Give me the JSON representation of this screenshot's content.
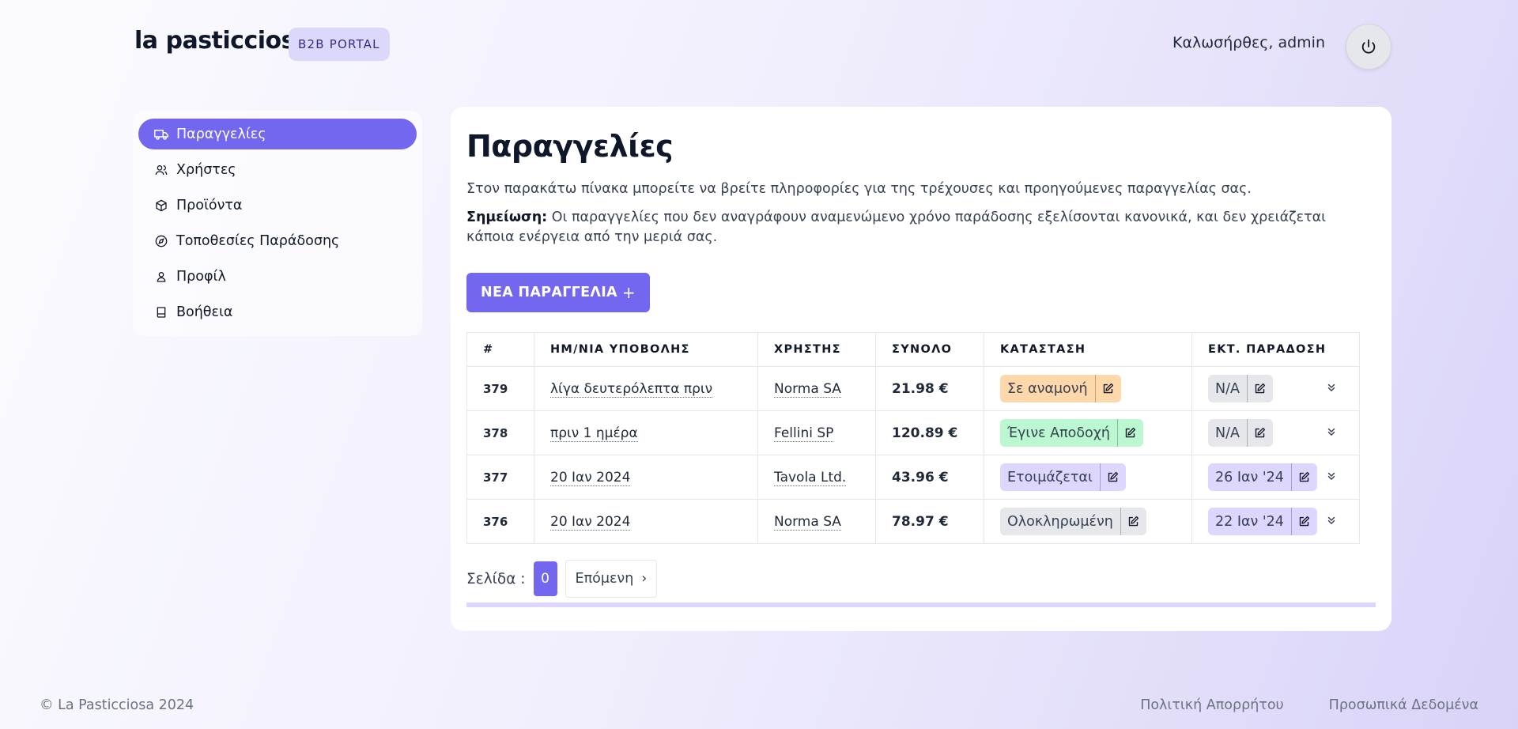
{
  "header": {
    "brand": "la pasticciosa",
    "badge": "B2B PORTAL",
    "welcome": "Καλωσήρθες, admin"
  },
  "sidebar": {
    "items": [
      {
        "label": "Παραγγελίες",
        "icon": "truck-icon",
        "active": true
      },
      {
        "label": "Χρήστες",
        "icon": "users-icon",
        "active": false
      },
      {
        "label": "Προϊόντα",
        "icon": "box-icon",
        "active": false
      },
      {
        "label": "Τοποθεσίες Παράδοσης",
        "icon": "compass-icon",
        "active": false
      },
      {
        "label": "Προφίλ",
        "icon": "user-icon",
        "active": false
      },
      {
        "label": "Βοήθεια",
        "icon": "book-icon",
        "active": false
      }
    ]
  },
  "main": {
    "title": "Παραγγελίες",
    "intro": "Στον παρακάτω πίνακα μπορείτε να βρείτε πληροφορίες για της τρέχουσες και προηγούμενες παραγγελίας σας.",
    "note_label": "Σημείωση:",
    "note_text": " Οι παραγγελίες που δεν αναγράφουν αναμενώμενο χρόνο παράδοσης εξελίσονται κανονικά, και δεν χρειάζεται κάποια ενέργεια από την μεριά σας.",
    "new_order_label": "ΝΕΑ ΠΑΡΑΓΓΕΛΙΑ",
    "new_order_icon": "+"
  },
  "table": {
    "headers": [
      "#",
      "ΗΜ/ΝΙΑ ΥΠΟΒΟΛΗΣ",
      "ΧΡΗΣΤΗΣ",
      "ΣΥΝΟΛΟ",
      "ΚΑΤΑΣΤΑΣΗ",
      "ΕΚΤ. ΠΑΡΑΔΟΣΗ"
    ],
    "rows": [
      {
        "id": "379",
        "date": "λίγα δευτερόλεπτα πριν",
        "user": "Norma SA",
        "total": "21.98 €",
        "status": "Σε αναμονή",
        "delivery": "N/A"
      },
      {
        "id": "378",
        "date": "πριν 1 ημέρα",
        "user": "Fellini SP",
        "total": "120.89 €",
        "status": "Έγινε Αποδοχή",
        "delivery": "N/A"
      },
      {
        "id": "377",
        "date": "20 Ιαν 2024",
        "user": "Tavola Ltd.",
        "total": "43.96 €",
        "status": "Ετοιμάζεται",
        "delivery": "26 Ιαν '24"
      },
      {
        "id": "376",
        "date": "20 Ιαν 2024",
        "user": "Norma SA",
        "total": "78.97 €",
        "status": "Ολοκληρωμένη",
        "delivery": "22 Ιαν '24"
      }
    ]
  },
  "pagination": {
    "label": "Σελίδα :",
    "current": "0",
    "next_label": "Επόμενη",
    "next_icon": "›"
  },
  "footer": {
    "copyright": "© La Pasticciosa 2024",
    "privacy": "Πολιτική Απορρήτου",
    "personal_data": "Προσωπικά Δεδομένα"
  },
  "colors": {
    "accent": "#7367f0",
    "status_waiting": "#fed7aa",
    "status_accepted": "#bbf7d0",
    "status_preparing": "#ddd6fe",
    "status_done": "#e5e7eb"
  }
}
